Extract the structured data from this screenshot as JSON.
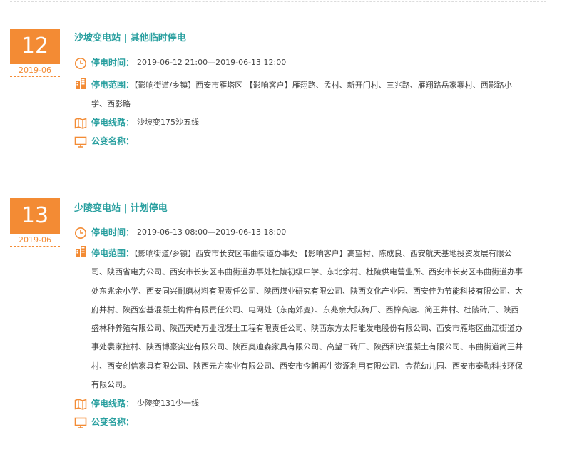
{
  "items": [
    {
      "day": "12",
      "year_month": "2019-06",
      "title": "沙坡变电站 | 其他临时停电",
      "time_label": "停电时间：",
      "time_value": "2019-06-12 21:00—2019-06-13 12:00",
      "range_label": "停电范围：",
      "range_value": "【影响街道/乡镇】西安市雁塔区 【影响客户】雁翔路、孟村、新开门村、三兆路、雁翔路岳家寨村、西影路小学、西影路",
      "line_label": "停电线路：",
      "line_value": "沙坡变175沙五线",
      "transformer_label": "公变名称：",
      "transformer_value": ""
    },
    {
      "day": "13",
      "year_month": "2019-06",
      "title": "少陵变电站 | 计划停电",
      "time_label": "停电时间：",
      "time_value": "2019-06-13 08:00—2019-06-13 18:00",
      "range_label": "停电范围：",
      "range_value": "【影响街道/乡镇】西安市长安区韦曲街道办事处 【影响客户】高望村、陈成良、西安航天基地投资发展有限公司、陕西省电力公司、西安市长安区韦曲街道办事处杜陵初级中学、东北余村、杜陵供电营业所、西安市长安区韦曲街道办事处东兆余小学、西安同兴耐磨材料有限责任公司、陕西煤业研究有限公司、陕西文化产业园、西安佳为节能科技有限公司、大府井村、陕西宏基混凝土构件有限责任公司、电网处（东南郊变）、东兆余大队砖厂、西榨高速、简王井村、杜陵砖厂、陕西盛林种养殖有限公司、陕西天皓万业混凝土工程有限责任公司、陕西东方太阳能发电股份有限公司、西安市雁塔区曲江街道办事处裴家控村、陕西博豪实业有限公司、陕西奥迪森家具有限公司、高望二砖厂、陕西和兴混凝土有限公司、韦曲街道简王井村、西安创信家具有限公司、陕西元方实业有限公司、西安市今朝再生资源利用有限公司、金花幼儿园、西安市泰勤科技环保有限公司。",
      "line_label": "停电线路：",
      "line_value": "少陵变131少一线",
      "transformer_label": "公变名称：",
      "transformer_value": ""
    }
  ],
  "colors": {
    "accent": "#f38b34",
    "teal": "#2aa0a0"
  },
  "icons": [
    "clock-icon",
    "building-icon",
    "map-icon",
    "monitor-icon"
  ]
}
